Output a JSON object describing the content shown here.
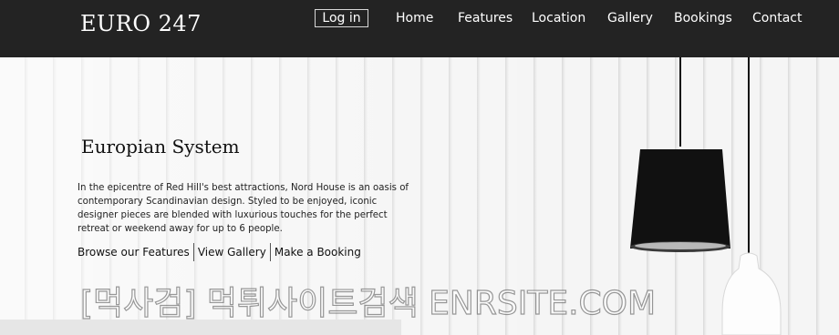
{
  "navbar": {
    "brand": "EURO 247",
    "login_label": "Log in",
    "links": [
      "Home",
      "Features",
      "Location",
      "Gallery",
      "Bookings",
      "Contact"
    ]
  },
  "hero": {
    "title": "Europian System",
    "description": "In the epicentre of Red Hill's best attractions, Nord House is an oasis of contemporary Scandinavian design. Styled to be enjoyed, iconic designer pieces are blended with luxurious touches for the perfect retreat or weekend away for up to 6 people.",
    "links": [
      "Browse our Features",
      "View Gallery",
      "Make a Booking"
    ]
  },
  "watermark": "[먹사검] 먹튀사이트검색 ENRSITE.COM",
  "colors": {
    "navbar_bg": "#232323",
    "nav_text": "#ffffff",
    "hero_bg": "#f3f3f3",
    "lamp_shade": "#111111"
  }
}
